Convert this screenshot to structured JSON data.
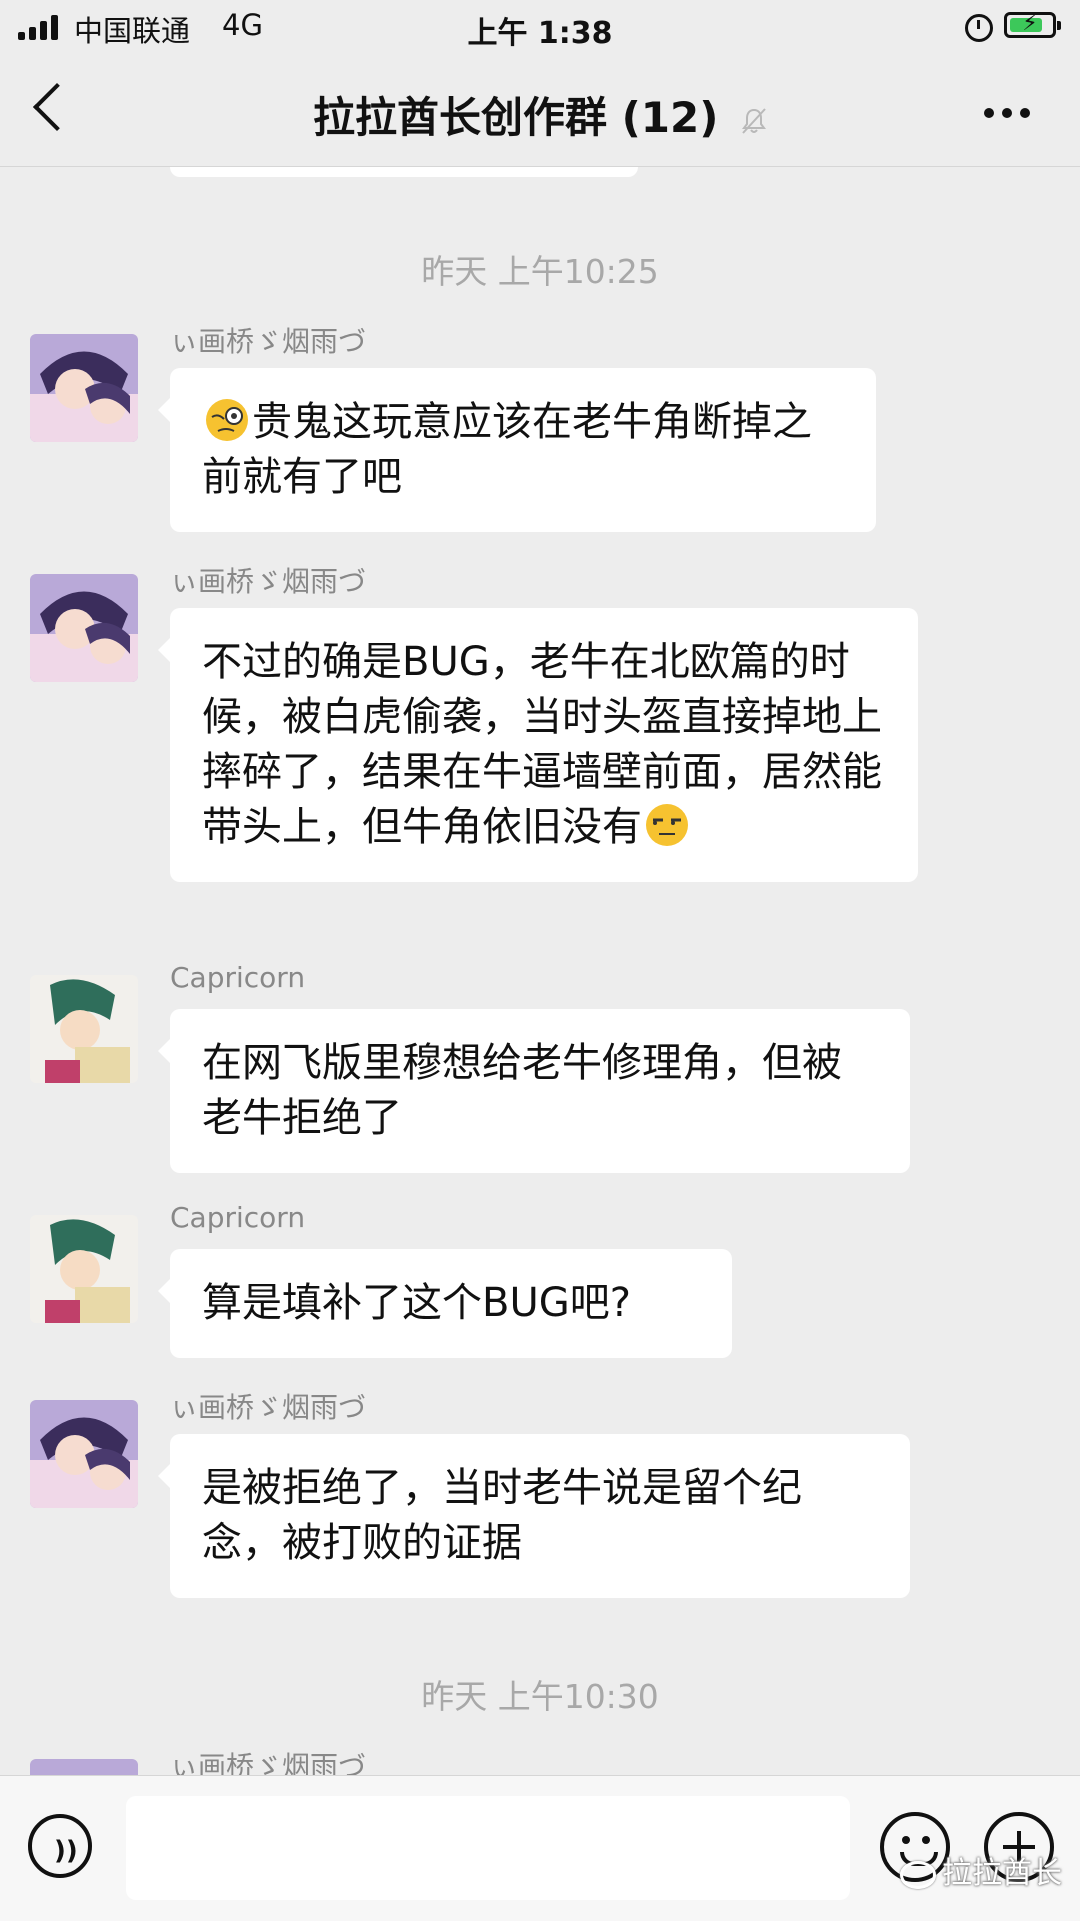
{
  "status_bar": {
    "carrier": "中国联通",
    "network": "4G",
    "time": "上午 1:38",
    "battery_level": 0.8
  },
  "header": {
    "title": "拉拉酋长创作群 (12)",
    "back_icon": "back-chevron-icon",
    "mute_icon": "bell-muted-icon",
    "more_icon": "more-dots-icon"
  },
  "chat": {
    "time_dividers": [
      "昨天 上午10:25",
      "昨天 上午10:30"
    ],
    "messages": [
      {
        "sender": "ぃ画桥ゞ烟雨づ",
        "emoji_before": "face-with-monocle-emoji",
        "text": "贵鬼这玩意应该在老牛角断掉之前就有了吧"
      },
      {
        "sender": "ぃ画桥ゞ烟雨づ",
        "text": "不过的确是BUG，老牛在北欧篇的时候，被白虎偷袭，当时头盔直接掉地上 摔碎了，结果在牛逼墙壁前面，居然能带头上，但牛角依旧没有",
        "emoji_after": "unamused-face-emoji"
      },
      {
        "sender": "Capricorn",
        "text": "在网飞版里穆想给老牛修理角，但被老牛拒绝了"
      },
      {
        "sender": "Capricorn",
        "text": "算是填补了这个BUG吧?"
      },
      {
        "sender": "ぃ画桥ゞ烟雨づ",
        "text": "是被拒绝了，当时老牛说是留个纪念，被打败的证据"
      },
      {
        "sender": "ぃ画桥ゞ烟雨づ",
        "text": ""
      }
    ]
  },
  "input_bar": {
    "voice_icon": "voice-icon",
    "emoji_icon": "emoji-icon",
    "add_icon": "plus-circle-icon",
    "input_value": ""
  },
  "watermark": {
    "text": "拉拉酋长"
  }
}
